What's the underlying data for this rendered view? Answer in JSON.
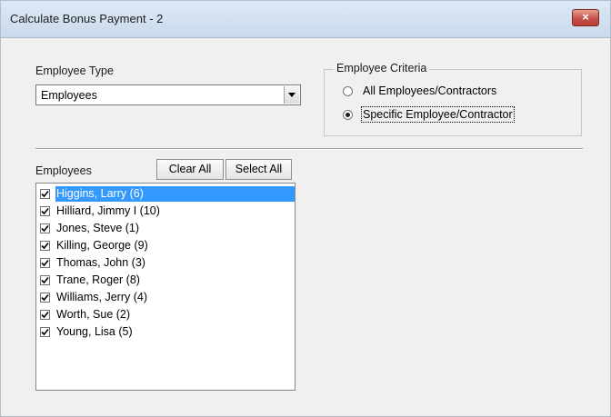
{
  "window": {
    "title": "Calculate Bonus Payment - 2",
    "close_glyph": "×"
  },
  "employee_type": {
    "label": "Employee Type",
    "selected": "Employees"
  },
  "criteria": {
    "legend": "Employee Criteria",
    "options": [
      {
        "label": "All Employees/Contractors",
        "checked": false
      },
      {
        "label": "Specific Employee/Contractor",
        "checked": true
      }
    ]
  },
  "employees": {
    "label": "Employees",
    "clear_all": "Clear All",
    "select_all": "Select All",
    "items": [
      {
        "name": "Higgins, Larry  (6)",
        "checked": true,
        "selected": true
      },
      {
        "name": "Hilliard, Jimmy I (10)",
        "checked": true,
        "selected": false
      },
      {
        "name": "Jones, Steve  (1)",
        "checked": true,
        "selected": false
      },
      {
        "name": "Killing, George  (9)",
        "checked": true,
        "selected": false
      },
      {
        "name": "Thomas, John  (3)",
        "checked": true,
        "selected": false
      },
      {
        "name": "Trane, Roger  (8)",
        "checked": true,
        "selected": false
      },
      {
        "name": "Williams, Jerry  (4)",
        "checked": true,
        "selected": false
      },
      {
        "name": "Worth, Sue  (2)",
        "checked": true,
        "selected": false
      },
      {
        "name": "Young, Lisa  (5)",
        "checked": true,
        "selected": false
      }
    ]
  },
  "colors": {
    "selection": "#3399ff",
    "close_button": "#c75050"
  }
}
